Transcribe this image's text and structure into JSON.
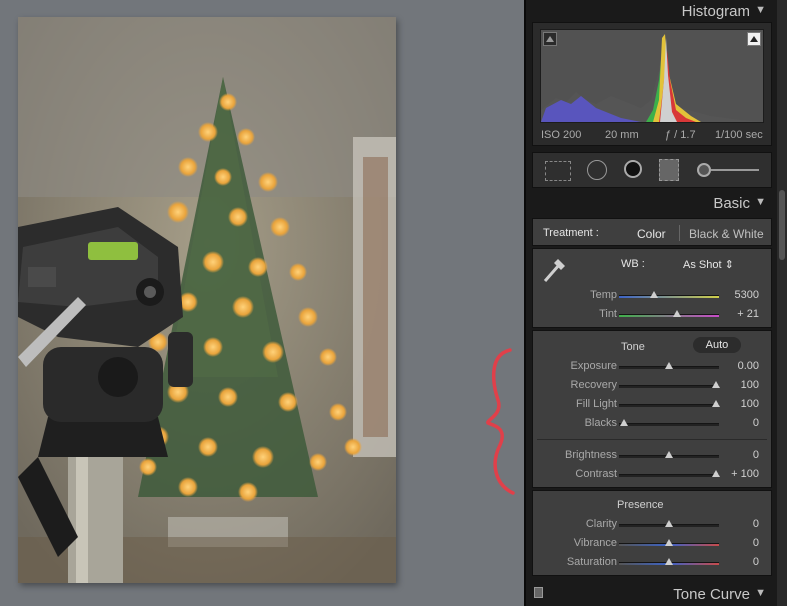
{
  "histogram": {
    "title": "Histogram",
    "iso": "ISO 200",
    "focal": "20 mm",
    "aperture": "ƒ / 1.7",
    "shutter": "1/100 sec"
  },
  "basic": {
    "title": "Basic",
    "treatment_label": "Treatment :",
    "treatment_color": "Color",
    "treatment_bw": "Black & White",
    "wb_label": "WB :",
    "wb_value": "As Shot ⇕",
    "temp_label": "Temp",
    "temp_value": "5300",
    "tint_label": "Tint",
    "tint_value": "+ 21",
    "tone_label": "Tone",
    "auto_label": "Auto",
    "exposure_label": "Exposure",
    "exposure_value": "0.00",
    "recovery_label": "Recovery",
    "recovery_value": "100",
    "fill_label": "Fill Light",
    "fill_value": "100",
    "blacks_label": "Blacks",
    "blacks_value": "0",
    "brightness_label": "Brightness",
    "brightness_value": "0",
    "contrast_label": "Contrast",
    "contrast_value": "+ 100",
    "presence_label": "Presence",
    "clarity_label": "Clarity",
    "clarity_value": "0",
    "vibrance_label": "Vibrance",
    "vibrance_value": "0",
    "saturation_label": "Saturation",
    "saturation_value": "0"
  },
  "tone_curve": {
    "title": "Tone Curve"
  },
  "colors": {
    "panel_bg": "#3f3f3f",
    "panel_dark": "#1a1a1a",
    "annotation": "#e0404a"
  },
  "sliders": {
    "temp": 0.35,
    "tint": 0.58,
    "exposure": 0.5,
    "recovery": 0.97,
    "fill": 0.97,
    "blacks": 0.05,
    "brightness": 0.5,
    "contrast": 0.97,
    "clarity": 0.5,
    "vibrance": 0.5,
    "saturation": 0.5
  }
}
